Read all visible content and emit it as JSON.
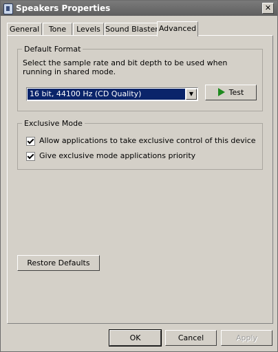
{
  "window": {
    "title": "Speakers Properties",
    "close_glyph": "✕"
  },
  "tabs": [
    {
      "label": "General",
      "active": false
    },
    {
      "label": "Tone",
      "active": false
    },
    {
      "label": "Levels",
      "active": false
    },
    {
      "label": "Sound Blaster",
      "active": false
    },
    {
      "label": "Advanced",
      "active": true
    }
  ],
  "default_format": {
    "legend": "Default Format",
    "description": "Select the sample rate and bit depth to be used when running in shared mode.",
    "selected_value": "16 bit, 44100 Hz (CD Quality)",
    "test_label": "Test"
  },
  "exclusive_mode": {
    "legend": "Exclusive Mode",
    "options": [
      {
        "label": "Allow applications to take exclusive control of this device",
        "checked": true
      },
      {
        "label": "Give exclusive mode applications priority",
        "checked": true
      }
    ]
  },
  "restore_label": "Restore Defaults",
  "dialog_buttons": {
    "ok": "OK",
    "cancel": "Cancel",
    "apply": "Apply"
  },
  "colors": {
    "selection": "#0a246a",
    "play_icon": "#1f8a1f",
    "title_bar": "#6a6a6a"
  }
}
